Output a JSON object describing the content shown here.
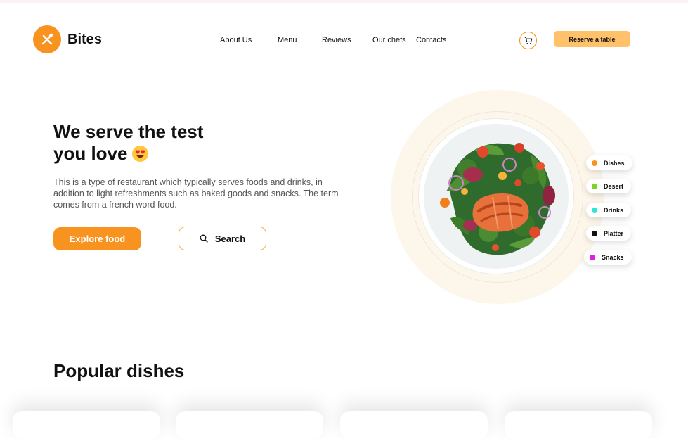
{
  "brand": {
    "name": "Bites",
    "color": "#f7931e",
    "icon": "fork-knife-icon"
  },
  "nav": {
    "items": [
      "About Us",
      "Menu",
      "Reviews",
      "Our chefs",
      "Contacts"
    ]
  },
  "header": {
    "cart_icon": "cart-icon",
    "reserve_label": "Reserve a table"
  },
  "hero": {
    "title_line1": "We serve the test",
    "title_line2": "you love",
    "emoji": "heart-eyes-emoji",
    "description": "This is a type of restaurant which typically serves foods and drinks, in addition to light refreshments such as baked goods and snacks. The term comes from a french word food.",
    "explore_label": "Explore food",
    "search_label": "Search",
    "search_icon": "search-icon",
    "image": "salmon-salad-plate"
  },
  "categories": [
    {
      "label": "Dishes",
      "color": "#f7931e"
    },
    {
      "label": "Desert",
      "color": "#7ed321"
    },
    {
      "label": "Drinks",
      "color": "#2ee6d6"
    },
    {
      "label": "Platter",
      "color": "#111111"
    },
    {
      "label": "Snacks",
      "color": "#e21ee2"
    }
  ],
  "popular": {
    "title": "Popular dishes"
  },
  "colors": {
    "accent": "#f7931e",
    "reserve_bg": "#ffc26b",
    "halo": "#fdf6ea"
  }
}
